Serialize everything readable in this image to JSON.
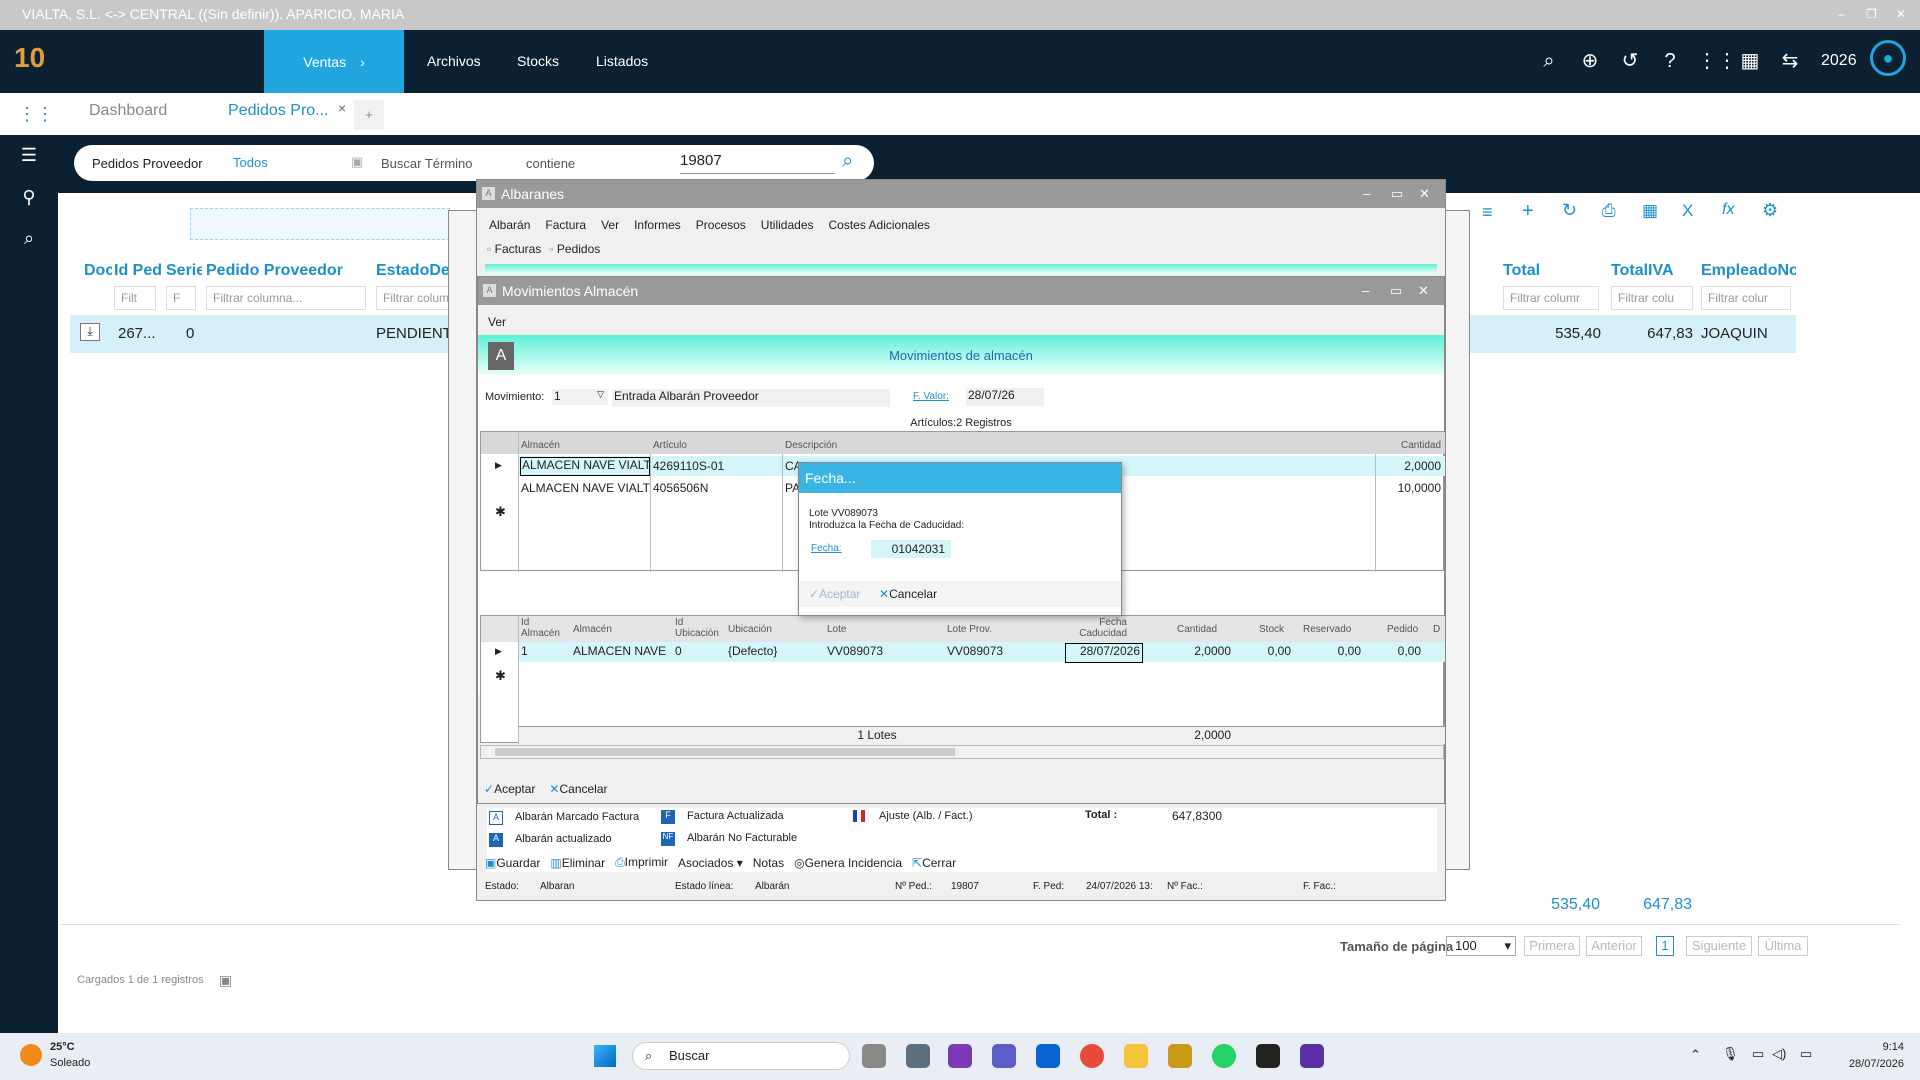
{
  "window": {
    "title": "VIALTA, S.L. <-> CENTRAL ((Sin definir)). APARICIO, MARIA"
  },
  "topnav": {
    "logo": "10",
    "menu": [
      "Ventas",
      "Archivos",
      "Stocks",
      "Listados"
    ],
    "year": "2026"
  },
  "tabs": {
    "dashboard": "Dashboard",
    "active": "Pedidos Pro...",
    "close": "×",
    "add": "+"
  },
  "search": {
    "entity": "Pedidos Proveedor",
    "scope": "Todos",
    "field": "Buscar Término",
    "op": "contiene",
    "value": "19807"
  },
  "grid": {
    "columns": [
      "Doc",
      "Id Pedi",
      "Serie",
      "Pedido Proveedor",
      "EstadoDes",
      "Total",
      "TotalIVA",
      "EmpleadoNon"
    ],
    "filters": [
      "Filt",
      "F",
      "Filtrar columna...",
      "Filtrar colum",
      "Filtrar columr",
      "Filtrar colu",
      "Filtrar colur"
    ],
    "row": {
      "id": "267...",
      "serie": "0",
      "estado": "PENDIENT",
      "total": "535,40",
      "totaliva": "647,83",
      "empleado": "JOAQUIN"
    },
    "footer_total": "535,40",
    "footer_totaliva": "647,83",
    "pagesize_label": "Tamaño de página",
    "pagesize": "100",
    "pager": [
      "Primera",
      "Anterior",
      "1",
      "Siguiente",
      "Última"
    ],
    "loaded": "Cargados 1 de 1 registros"
  },
  "albaranes": {
    "title": "Albaranes",
    "menu": [
      "Albarán",
      "Factura",
      "Ver",
      "Informes",
      "Procesos",
      "Utilidades",
      "Costes Adicionales"
    ],
    "sub": [
      "Facturas",
      "Pedidos"
    ],
    "legend": [
      "Albarán Marcado Factura",
      "Factura Actualizada",
      "Ajuste  (Alb. / Fact.)",
      "Albarán actualizado",
      "Albarán No Facturable"
    ],
    "total_label": "Total :",
    "total": "647,8300",
    "toolbar": [
      "Guardar",
      "Eliminar",
      "Imprimir",
      "Asociados",
      "Notas",
      "Genera Incidencia",
      "Cerrar"
    ],
    "status": {
      "estado_l": "Estado:",
      "estado": "Albaran",
      "linea_l": "Estado línea:",
      "linea": "Albarán",
      "ped_l": "Nº Ped.:",
      "ped": "19807",
      "fped_l": "F. Ped:",
      "fped": "24/07/2026 13:",
      "fac_l": "Nº Fac.:",
      "ffac_l": "F. Fac.:"
    }
  },
  "movimientos": {
    "title": "Movimientos Almacén",
    "menu": "Ver",
    "banner": "Movimientos de almacén",
    "mov_label": "Movimiento:",
    "mov_num": "1",
    "mov_desc": "Entrada Albarán Proveedor",
    "fvalor_label": "F. Valor:",
    "fvalor": "28/07/26",
    "articulos": "Artículos:2 Registros",
    "cols": [
      "Almacén",
      "Artículo",
      "Descripción",
      "Cantidad"
    ],
    "rows": [
      {
        "alm": "ALMACEN NAVE VIALT",
        "art": "4269110S-01",
        "desc": "CA",
        "cant": "2,0000"
      },
      {
        "alm": "ALMACEN NAVE VIALT",
        "art": "4056506N",
        "desc": "PA",
        "cant": "10,0000"
      }
    ],
    "lcols": [
      "Id Almacén",
      "Almacén",
      "Id Ubicación",
      "Ubicación",
      "Lote",
      "Lote Prov.",
      "Fecha Caducidad",
      "Cantidad",
      "Stock",
      "Reservado",
      "Pedido",
      "D"
    ],
    "lrow": {
      "id": "1",
      "alm": "ALMACEN NAVE",
      "idub": "0",
      "ub": "{Defecto}",
      "lote": "VV089073",
      "lprov": "VV089073",
      "fcad": "28/07/2026",
      "cant": "2,0000",
      "stock": "0,00",
      "res": "0,00",
      "ped": "0,00"
    },
    "lotes": "1 Lotes",
    "lotes_total": "2,0000",
    "aceptar": "Aceptar",
    "cancelar": "Cancelar"
  },
  "fecha_dialog": {
    "title": "Fecha...",
    "line1": "Lote VV089073",
    "line2": "Introduzca la Fecha de Caducidad:",
    "label": "Fecha:",
    "value": "01042031",
    "ok": "Aceptar",
    "cancel": "Cancelar"
  },
  "taskbar": {
    "temp": "25°C",
    "weather": "Soleado",
    "search": "Buscar",
    "time": "9:14",
    "date": "28/07/2026"
  }
}
